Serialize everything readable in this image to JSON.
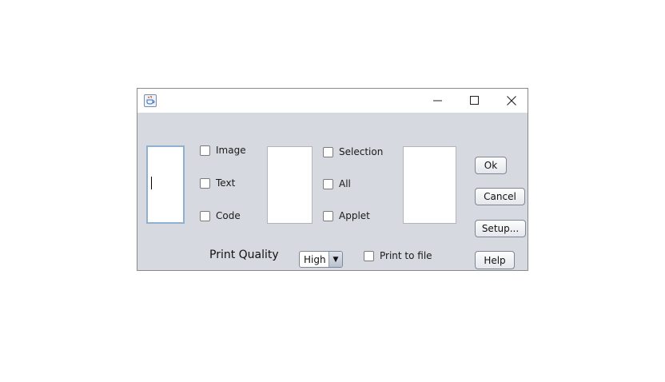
{
  "window": {
    "app_icon": "java-coffee-cup-icon",
    "controls": {
      "minimize": "minimize-icon",
      "maximize": "maximize-icon",
      "close": "close-icon"
    }
  },
  "checkboxes": {
    "image": "Image",
    "text": "Text",
    "code": "Code",
    "selection": "Selection",
    "all": "All",
    "applet": "Applet",
    "print_to_file": "Print to file"
  },
  "buttons": {
    "ok": "Ok",
    "cancel": "Cancel",
    "setup": "Setup...",
    "help": "Help"
  },
  "print_quality": {
    "label": "Print Quality",
    "selected": "High",
    "arrow": "▼"
  }
}
